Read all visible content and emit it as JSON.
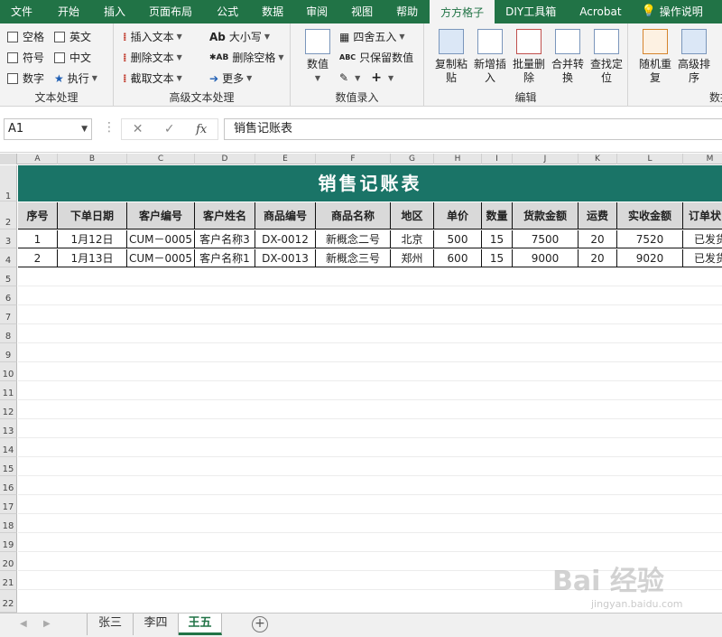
{
  "tabs": [
    "文件",
    "开始",
    "插入",
    "页面布局",
    "公式",
    "数据",
    "审阅",
    "视图",
    "帮助",
    "方方格子",
    "DIY工具箱",
    "Acrobat",
    "操作说明"
  ],
  "active_tab": "方方格子",
  "ribbon": {
    "text_proc": {
      "checks": [
        "空格",
        "英文",
        "符号",
        "中文",
        "数字"
      ],
      "exec": "执行",
      "label": "文本处理"
    },
    "adv_text": {
      "items": [
        "插入文本",
        "删除文本",
        "截取文本"
      ],
      "items2": [
        "大小写",
        "删除空格",
        "更多"
      ],
      "label": "高级文本处理"
    },
    "num_input": {
      "big": "数值",
      "items": [
        "四舍五入",
        "只保留数值"
      ],
      "label": "数值录入"
    },
    "edit": {
      "buttons": [
        "复制粘\n贴",
        "新增插\n入",
        "批量删\n除",
        "合并转\n换",
        "查找定\n位"
      ],
      "label": "编辑"
    },
    "data": {
      "buttons": [
        "随机重\n复",
        "高级排\n序"
      ],
      "label": "数据"
    }
  },
  "formula_bar": {
    "name_box": "A1",
    "formula": "销售记账表"
  },
  "columns": [
    "A",
    "B",
    "C",
    "D",
    "E",
    "F",
    "G",
    "H",
    "I",
    "J",
    "K",
    "L",
    "M"
  ],
  "rows": [
    "1",
    "2",
    "3",
    "4",
    "5",
    "6",
    "7",
    "8",
    "9",
    "10",
    "11",
    "12",
    "13",
    "14",
    "15",
    "16",
    "17",
    "18",
    "19",
    "20",
    "21",
    "22"
  ],
  "sheet": {
    "title": "销售记账表",
    "headers": [
      "序号",
      "下单日期",
      "客户编号",
      "客户姓名",
      "商品编号",
      "商品名称",
      "地区",
      "单价",
      "数量",
      "货款金额",
      "运费",
      "实收金额",
      "订单状"
    ],
    "data": [
      [
        "1",
        "1月12日",
        "CUM－0005",
        "客户名称3",
        "DX-0012",
        "新概念二号",
        "北京",
        "500",
        "15",
        "7500",
        "20",
        "7520",
        "已发货"
      ],
      [
        "2",
        "1月13日",
        "CUM－0005",
        "客户名称1",
        "DX-0013",
        "新概念三号",
        "郑州",
        "600",
        "15",
        "9000",
        "20",
        "9020",
        "已发货"
      ]
    ]
  },
  "sheet_tabs": [
    "张三",
    "李四",
    "王五"
  ],
  "active_sheet": "王五",
  "watermark": {
    "main": "Bai 经验",
    "sub": "jingyan.baidu.com"
  }
}
